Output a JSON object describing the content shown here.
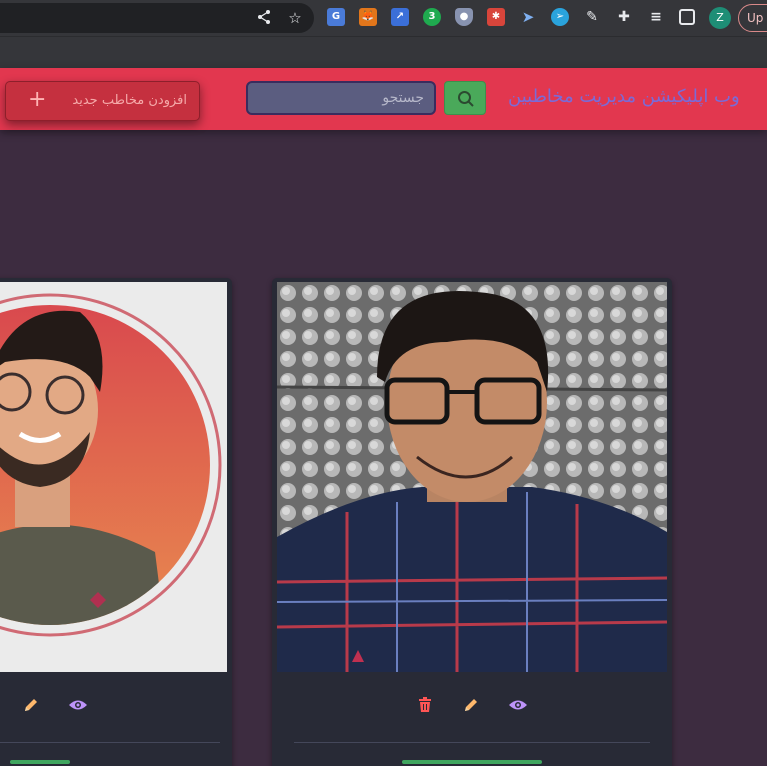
{
  "browser": {
    "profile_initial": "Z",
    "update_label": "Up",
    "extensions": [
      "google-translate-icon",
      "metamask-icon",
      "extension-blue-icon",
      "extension-green-3-icon",
      "shield-extension-icon",
      "extension-red-icon",
      "arrow-extension-icon",
      "telegram-icon",
      "color-picker-icon",
      "puzzle-icon",
      "reading-list-icon",
      "side-panel-icon"
    ],
    "extension_3_label": "3"
  },
  "navbar": {
    "brand": "وب اپلیکیشن مدیریت مخاطبین",
    "search_placeholder": "جستجو",
    "add_contact_label": "افزودن مخاطب جدید",
    "add_icon": "+"
  },
  "colors": {
    "navbar": "#e2374f",
    "background": "#3d2c40",
    "card": "#282a36",
    "search_button": "#4aa95a",
    "delete": "#ff5555",
    "edit": "#ffb86c",
    "view": "#bd93f9"
  },
  "contacts": [
    {
      "card": "left",
      "photo": "contact-photo-circular-portrait",
      "actions": [
        "edit-icon",
        "view-icon"
      ]
    },
    {
      "card": "right",
      "photo": "contact-photo-selfie",
      "actions": [
        "delete-icon",
        "edit-icon",
        "view-icon"
      ]
    }
  ]
}
